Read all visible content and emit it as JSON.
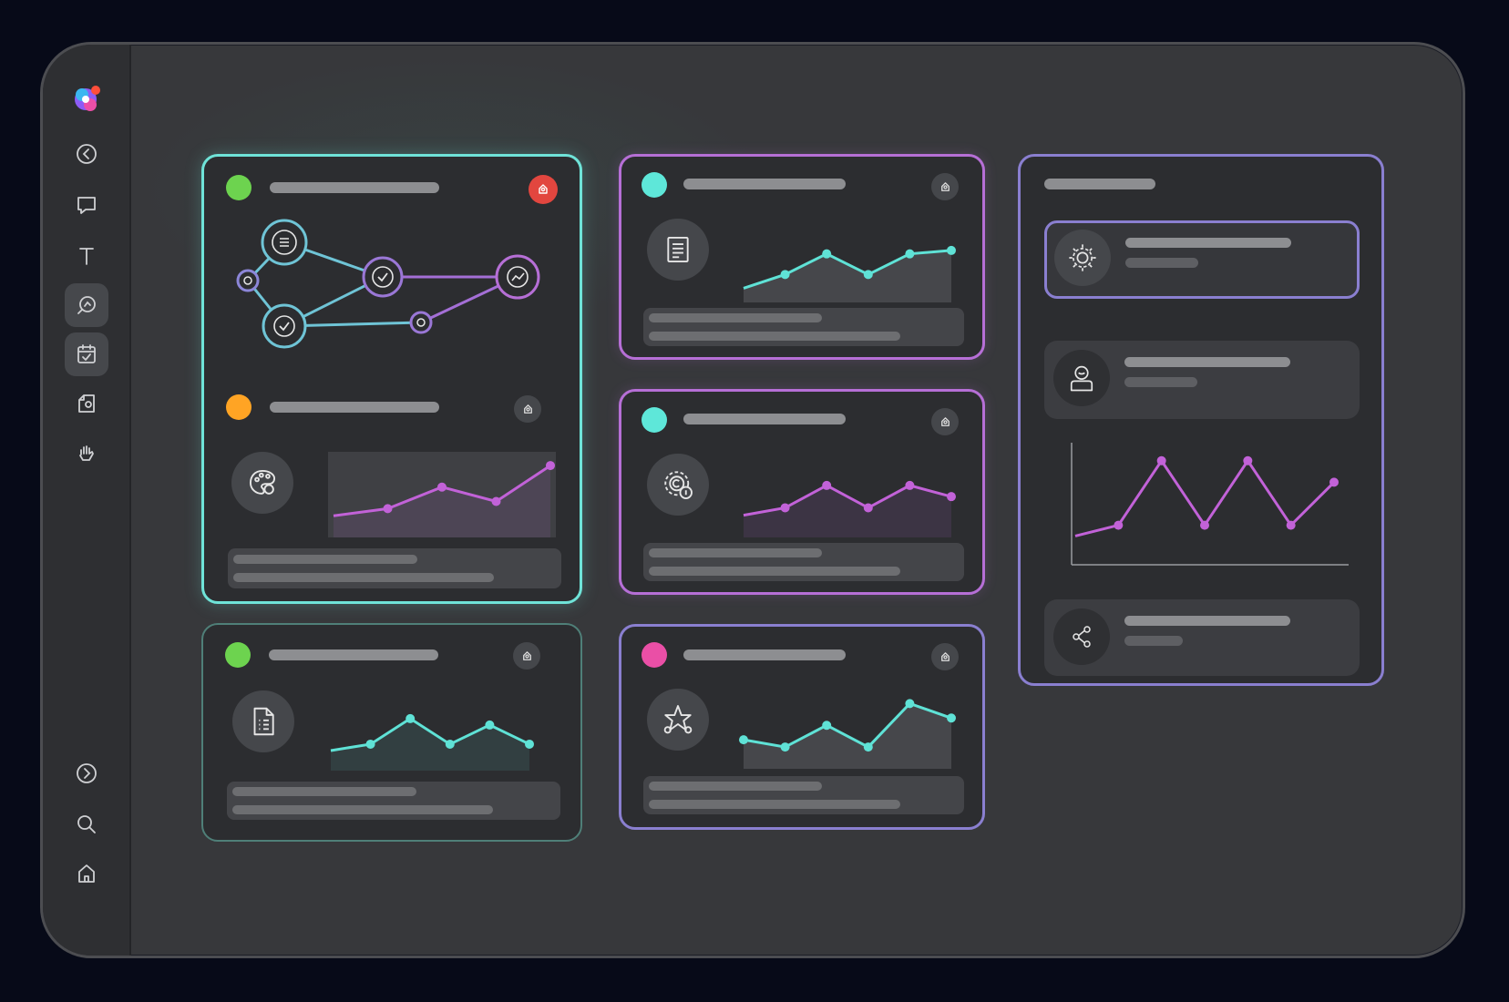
{
  "theme": {
    "teal": "#6fe3d8",
    "purple": "#b66fd6",
    "lavender": "#8a7fd0",
    "green": "#6dd34f",
    "orange": "#ffa424",
    "pink": "#ea4fa6",
    "red": "#e2463f",
    "background": "#070a18"
  },
  "sidebar": {
    "items": [
      {
        "icon": "history-icon"
      },
      {
        "icon": "comment-icon"
      },
      {
        "icon": "text-icon"
      },
      {
        "icon": "search-analytics-icon",
        "active": true
      },
      {
        "icon": "calendar-check-icon",
        "active": true
      },
      {
        "icon": "document-icon"
      },
      {
        "icon": "hand-icon"
      }
    ],
    "bottom_items": [
      {
        "icon": "arrow-right-circle-icon"
      },
      {
        "icon": "search-icon"
      },
      {
        "icon": "home-icon"
      }
    ]
  },
  "cards": [
    {
      "id": "workflow",
      "status_color": "#6dd34f",
      "badge": "alert-icon",
      "graph_nodes": [
        "list-icon",
        "check-icon",
        "check-icon",
        "trend-icon"
      ]
    },
    {
      "id": "palette",
      "status_color": "#ffa424",
      "badge": "bell-icon",
      "icon": "palette-icon",
      "series": [
        2,
        3,
        6,
        4,
        9
      ]
    },
    {
      "id": "doc-list",
      "status_color": "#6dd34f",
      "badge": "bell-icon",
      "icon": "doc-list-icon",
      "series": [
        2,
        3,
        7,
        3,
        6,
        3
      ]
    },
    {
      "id": "document",
      "status_color": "#5ee7d9",
      "badge": "bell-icon",
      "icon": "document-icon",
      "series": [
        1,
        3,
        6,
        3,
        6,
        6.5
      ]
    },
    {
      "id": "settings",
      "status_color": "#5ee7d9",
      "badge": "bell-icon",
      "icon": "settings-badge-icon",
      "series": [
        2,
        3,
        6,
        3,
        6,
        4.5
      ]
    },
    {
      "id": "star",
      "status_color": "#ea4fa6",
      "badge": "bell-icon",
      "icon": "star-icon",
      "series": [
        3,
        2,
        5,
        2,
        8,
        6
      ]
    }
  ],
  "panel": {
    "rows": [
      {
        "icon": "gear-icon",
        "selected": true
      },
      {
        "icon": "user-icon"
      },
      {
        "icon": "share-icon"
      }
    ],
    "chart_series": [
      2,
      3,
      9,
      3,
      9,
      3,
      7
    ]
  }
}
